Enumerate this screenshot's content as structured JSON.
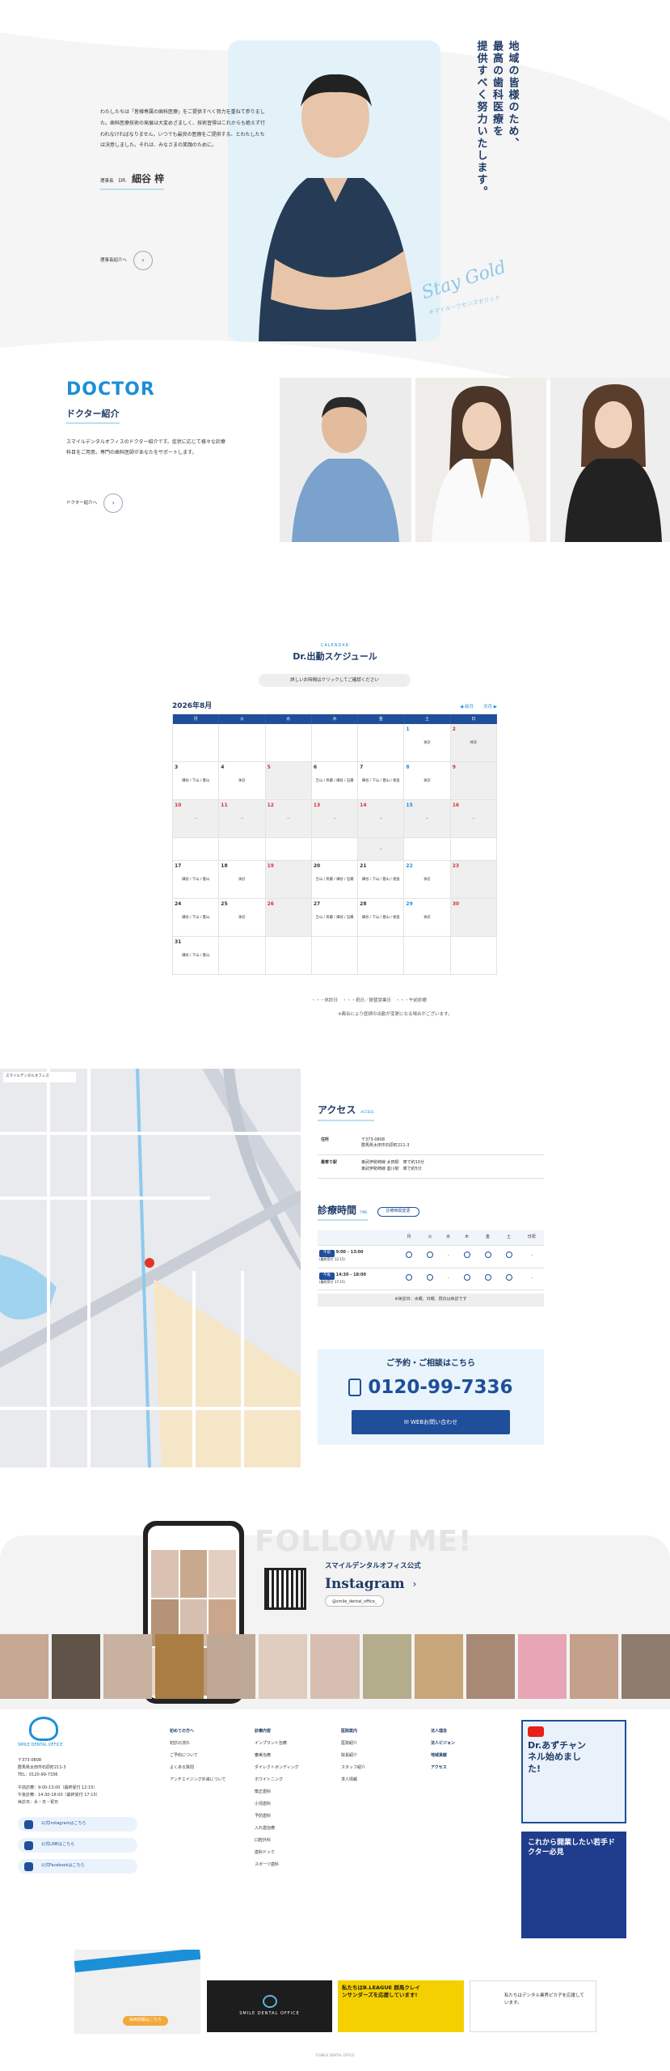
{
  "colors": {
    "navy": "#1f3a67",
    "blue": "#1b8fd8",
    "light_blue": "#e3f2f8",
    "gray": "#f4f4f4"
  },
  "hero": {
    "heading_lines": [
      "地域の皆様のため、",
      "最高の歯科医療を",
      "提供すべく努力いたします。"
    ],
    "message": "わたしたちは「皆様専属の歯科医療」をご提供すべく努力を重ねて参りました。歯科医療技術の発展は大変めざましく、技術習得はこれからも絶えず行われなければなりません。いつでも最良の医療をご提供する、とわたしたちは決意しました。それは、みなさまの笑顔のために。",
    "role": "理事長",
    "title": "DR.",
    "name": "細谷 梓",
    "greeting_link": "理事長紹介へ",
    "signature": "Stay Gold",
    "signature_sub": "#マイルーツセンスモリット"
  },
  "doctor": {
    "label_en": "DOCTOR",
    "label_jp": "ドクター紹介",
    "desc": "スマイルデンタルオフィスのドクター紹介です。症状に応じて様々な診療科目をご用意。専門の歯科医師があなたをサポートします。",
    "link": "ドクター紹介へ"
  },
  "schedule": {
    "label_en": "CALENDAR",
    "title": "Dr.出勤スケジュール",
    "notice": "詳しいお時間はクリックしてご確認ください",
    "month": "2026年8月",
    "prev": "◀ 前月",
    "next": "次月 ▶",
    "dows": [
      "月",
      "火",
      "水",
      "木",
      "金",
      "土",
      "日"
    ],
    "weeks": [
      [
        {
          "d": "",
          "off": false
        },
        {
          "d": "",
          "off": false
        },
        {
          "d": "",
          "off": false
        },
        {
          "d": "",
          "off": false
        },
        {
          "d": "",
          "off": false
        },
        {
          "d": "1",
          "t": "休診",
          "off": false
        },
        {
          "d": "2",
          "t": "休診",
          "s": true,
          "off": true
        }
      ],
      [
        {
          "d": "3",
          "t": "細谷 / 下山 / 菱山",
          "off": false
        },
        {
          "d": "4",
          "t": "休診",
          "off": false
        },
        {
          "d": "5",
          "t": "",
          "s": true,
          "off": true
        },
        {
          "d": "6",
          "t": "吉山 / 斉藤 / 細谷 / 石橋",
          "off": false
        },
        {
          "d": "7",
          "t": "細谷 / 下山 / 菱山 / 相良",
          "off": false
        },
        {
          "d": "8",
          "t": "休診",
          "off": false
        },
        {
          "d": "9",
          "t": "",
          "s": true,
          "off": true
        }
      ],
      [
        {
          "d": "10",
          "t": "--",
          "s": true,
          "off": true
        },
        {
          "d": "11",
          "t": "--",
          "s": true,
          "off": true
        },
        {
          "d": "12",
          "t": "--",
          "s": true,
          "off": true
        },
        {
          "d": "13",
          "t": "--",
          "s": true,
          "off": true
        },
        {
          "d": "14",
          "t": "--",
          "s": true,
          "off": true
        },
        {
          "d": "15",
          "t": "--",
          "s": true,
          "off": true
        },
        {
          "d": "16",
          "t": "--",
          "s": true,
          "off": true
        }
      ],
      [
        {
          "d": "",
          "off": false
        },
        {
          "d": "",
          "off": false
        },
        {
          "d": "",
          "off": false
        },
        {
          "d": "",
          "off": false
        },
        {
          "d": "",
          "t": "--",
          "off": true
        },
        {
          "d": "",
          "off": false
        },
        {
          "d": "",
          "off": false
        }
      ],
      [
        {
          "d": "17",
          "t": "細谷 / 下山 / 菱山",
          "off": false
        },
        {
          "d": "18",
          "t": "休診",
          "off": false
        },
        {
          "d": "19",
          "t": "",
          "s": true,
          "off": true
        },
        {
          "d": "20",
          "t": "吉山 / 斉藤 / 細谷 / 石橋",
          "off": false
        },
        {
          "d": "21",
          "t": "細谷 / 下山 / 菱山 / 相良",
          "off": false
        },
        {
          "d": "22",
          "t": "休診",
          "off": false
        },
        {
          "d": "23",
          "t": "",
          "s": true,
          "off": true
        }
      ],
      [
        {
          "d": "24",
          "t": "細谷 / 下山 / 菱山",
          "off": false
        },
        {
          "d": "25",
          "t": "休診",
          "off": false
        },
        {
          "d": "26",
          "t": "",
          "s": true,
          "off": true
        },
        {
          "d": "27",
          "t": "吉山 / 斉藤 / 細谷 / 石橋",
          "off": false
        },
        {
          "d": "28",
          "t": "細谷 / 下山 / 菱山 / 相良",
          "off": false
        },
        {
          "d": "29",
          "t": "休診",
          "off": false
        },
        {
          "d": "30",
          "t": "",
          "s": true,
          "off": true
        }
      ],
      [
        {
          "d": "31",
          "t": "細谷 / 下山 / 菱山",
          "off": false
        },
        {
          "d": "",
          "off": false
        },
        {
          "d": "",
          "off": false
        },
        {
          "d": "",
          "off": false
        },
        {
          "d": "",
          "off": false
        },
        {
          "d": "",
          "off": false
        },
        {
          "d": "",
          "off": false
        }
      ]
    ],
    "legend": "・・・休診日　・・・祝日／振替営業日　・・・午前診療",
    "footnote": "※都合により医師の出勤が変更になる場合がございます。"
  },
  "access": {
    "title": "アクセス",
    "title_en": "ACCESS",
    "address_label": "住所",
    "address": "〒373-0808\n群馬県太田市石原町211-3",
    "station_label": "最寄り駅",
    "station": "東武伊勢崎線 太田駅　車で約10分\n東武伊勢崎線 韮川駅　車で約5分",
    "hours_title": "診療時間",
    "hours_en": "TIME",
    "hours_btn": "診療時間変更",
    "days": [
      "月",
      "火",
      "水",
      "木",
      "金",
      "土",
      "日祝"
    ],
    "am_tag": "午前",
    "am": "9:00 - 13:00",
    "am_sub": "(最終受付 12:15)",
    "pm_tag": "午後",
    "pm": "14:30 - 18:00",
    "pm_sub": "(最終受付 17:15)",
    "hours_note": "※休診日：水曜、日曜、祝日は休診です",
    "reserve": "ご予約・ご相談はこちら",
    "tel": "0120-99-7336",
    "web": "WEBお問い合わせ",
    "map_label": "スマイルデンタルオフィス"
  },
  "follow": {
    "title": "FOLLOW ME!",
    "clinic": "スマイルデンタルオフィス公式",
    "ig": "Instagram",
    "handle": "@smile_dental_office_"
  },
  "footer": {
    "logo_text": "SMILE DENTAL OFFICE",
    "address": "〒373-0808\n群馬県太田市石原町211-3\nTEL：0120-99-7336",
    "hours": "午前診療：9:00-13:00（最終受付 12:15）\n午後診療：14:30-18:00（最終受付 17:15）\n休診日：水・日・祝日",
    "sns": [
      "公式Instagramはこちら",
      "公式LINEはこちら",
      "公式Facebookはこちら"
    ],
    "col1": [
      "初めての方へ",
      "初診の流れ",
      "ご予約について",
      "よくある質問",
      "アンチエイジング外来について"
    ],
    "col2": [
      "診療内容",
      "インプラント治療",
      "審美治療",
      "ダイレクトボンディング",
      "ホワイトニング",
      "矯正歯科",
      "小児歯科",
      "予防歯科",
      "入れ歯治療",
      "口腔外科",
      "歯科ドック",
      "スポーツ歯科"
    ],
    "col3": [
      "医院案内",
      "医院紹介",
      "院長紹介",
      "スタッフ紹介",
      "求人情報"
    ],
    "col4": [
      "法人理念",
      "法人ビジョン",
      "地域貢献",
      "アクセス"
    ],
    "youtube": "Dr.あずチャンネル始めました!",
    "youtube_sub": "これから開業したい若手ドクター必見",
    "banner1": "採用情報はこちら",
    "banner2": "SMILE DENTAL OFFICE",
    "banner3": "私たちはB.LEAGUE 群馬クレインサンダーズを応援しています!",
    "banner4": "私たちはデンタル業界ピカ子を応援しています。",
    "copyright": "©SMILE DENTAL OFFICE"
  }
}
